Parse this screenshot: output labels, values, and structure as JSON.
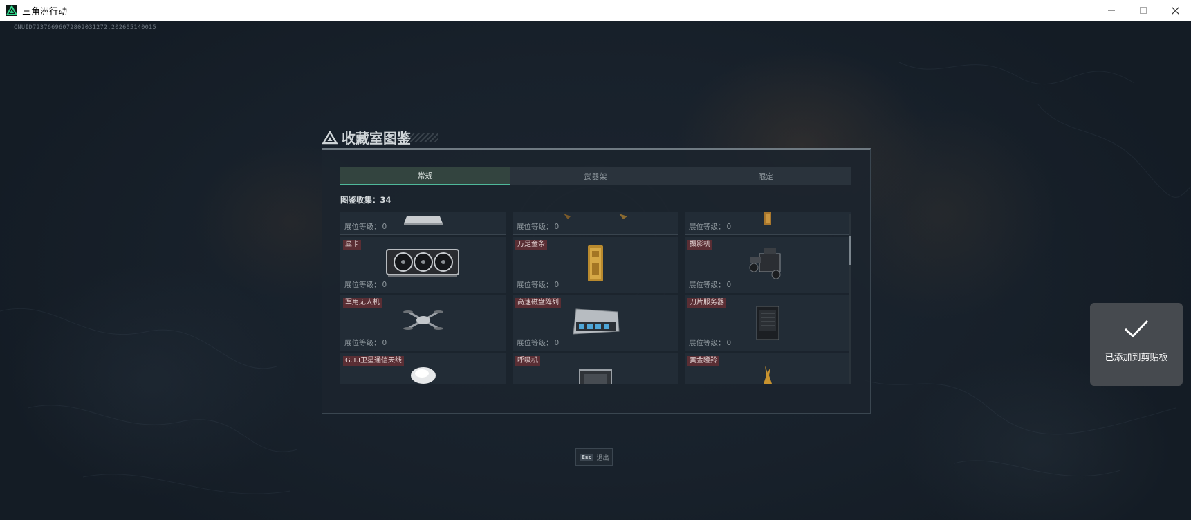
{
  "window": {
    "title": "三角洲行动",
    "logo_icon": "delta-force-logo",
    "controls": [
      "minimize-icon",
      "maximize-icon",
      "close-icon"
    ]
  },
  "game": {
    "uid": "CNUID72376696072802031272,202605140015"
  },
  "panel": {
    "title": "收藏室图鉴",
    "tabs": [
      {
        "label": "常规",
        "active": true
      },
      {
        "label": "武器架",
        "active": false
      },
      {
        "label": "限定",
        "active": false
      }
    ],
    "collect_label": "图鉴收集：",
    "collect_count": "34",
    "level_label": "展位等级：",
    "rows": [
      [
        {
          "name": "",
          "level": "0",
          "icon": "laptop-icon"
        },
        {
          "name": "",
          "level": "0",
          "icon": "artifact-icon"
        },
        {
          "name": "",
          "level": "0",
          "icon": "gold-relic-icon"
        }
      ],
      [
        {
          "name": "显卡",
          "level": "0",
          "icon": "graphics-card-icon"
        },
        {
          "name": "万足金条",
          "level": "0",
          "icon": "gold-bar-icon"
        },
        {
          "name": "摄影机",
          "level": "0",
          "icon": "camera-icon"
        }
      ],
      [
        {
          "name": "军用无人机",
          "level": "0",
          "icon": "drone-icon"
        },
        {
          "name": "高速磁盘阵列",
          "level": "0",
          "icon": "disk-array-icon"
        },
        {
          "name": "刀片服务器",
          "level": "0",
          "icon": "blade-server-icon"
        }
      ],
      [
        {
          "name": "G.T.I卫星通信天线",
          "level": "",
          "icon": "satellite-dish-icon"
        },
        {
          "name": "呼吸机",
          "level": "",
          "icon": "ventilator-icon"
        },
        {
          "name": "黄金瞪羚",
          "level": "",
          "icon": "gold-gazelle-icon"
        }
      ]
    ]
  },
  "footer": {
    "esc_key": "Esc",
    "esc_label": "退出"
  },
  "toast": {
    "icon": "checkmark-icon",
    "message": "已添加到剪贴板"
  },
  "colors": {
    "accent": "#4fb89a",
    "name_tag": "#5a2e34",
    "panel_bg": "#1c242d"
  }
}
